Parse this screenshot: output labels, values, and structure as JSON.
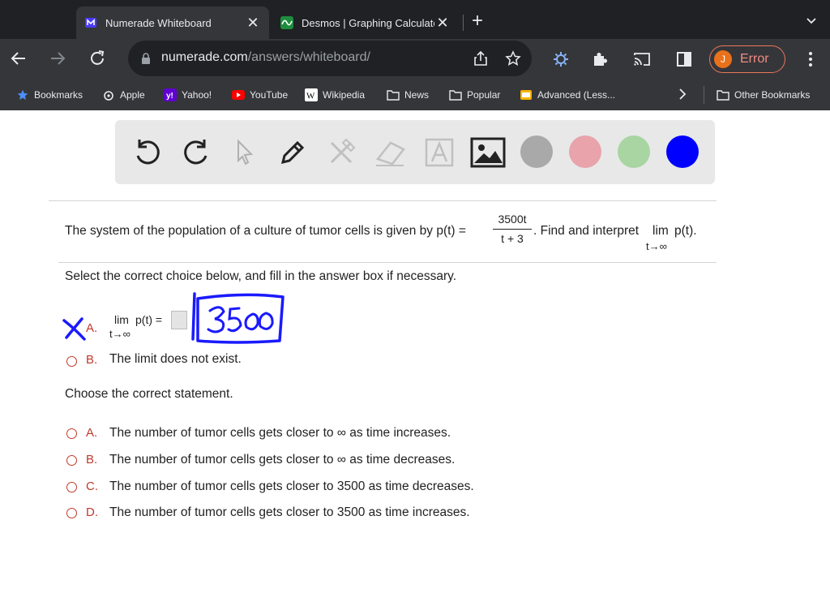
{
  "browser": {
    "tabs": [
      {
        "title": "Numerade Whiteboard",
        "active": true
      },
      {
        "title": "Desmos | Graphing Calculato",
        "active": false
      }
    ],
    "url_host": "numerade.com",
    "url_path": "/answers/whiteboard/",
    "profile_initial": "J",
    "profile_status": "Error",
    "bookmarks": [
      "Bookmarks",
      "Apple",
      "Yahoo!",
      "YouTube",
      "Wikipedia",
      "News",
      "Popular",
      "Advanced (Less...",
      "Other Bookmarks"
    ],
    "colors": {
      "accent_error": "#f28b82",
      "avatar": "#e8711a"
    }
  },
  "whiteboard": {
    "tools": [
      "undo-icon",
      "redo-icon",
      "pointer-icon",
      "pen-icon",
      "tools-icon",
      "eraser-icon",
      "text-box-icon",
      "image-icon"
    ],
    "swatches": [
      "#a9a9a9",
      "#e8a3ab",
      "#a8d5a2",
      "#0000ff"
    ]
  },
  "question": {
    "prompt_start": "The system of the population of a culture of tumor cells is given by p(t) =",
    "fraction_num": "3500t",
    "fraction_den": "t + 3",
    "prompt_end": ". Find and interpret",
    "lim": "lim",
    "lim_sub": "t→∞",
    "lim_expr": "p(t).",
    "instruction": "Select the correct choice below, and fill in the answer box if necessary.",
    "choice_a_letter": "A.",
    "choice_a_lim": "lim",
    "choice_a_lim_sub": "t→∞",
    "choice_a_expr": "p(t) =",
    "choice_a_handwritten": "3500",
    "choice_b_letter": "B.",
    "choice_b_text": "The limit does not exist.",
    "statement_prompt": "Choose the correct statement.",
    "statements": [
      {
        "letter": "A.",
        "text": "The number of tumor cells gets closer to ∞ as time increases."
      },
      {
        "letter": "B.",
        "text": "The number of tumor cells gets closer to ∞ as time decreases."
      },
      {
        "letter": "C.",
        "text": "The number of tumor cells gets closer to 3500 as time decreases."
      },
      {
        "letter": "D.",
        "text": "The number of tumor cells gets closer to 3500 as time increases."
      }
    ]
  }
}
